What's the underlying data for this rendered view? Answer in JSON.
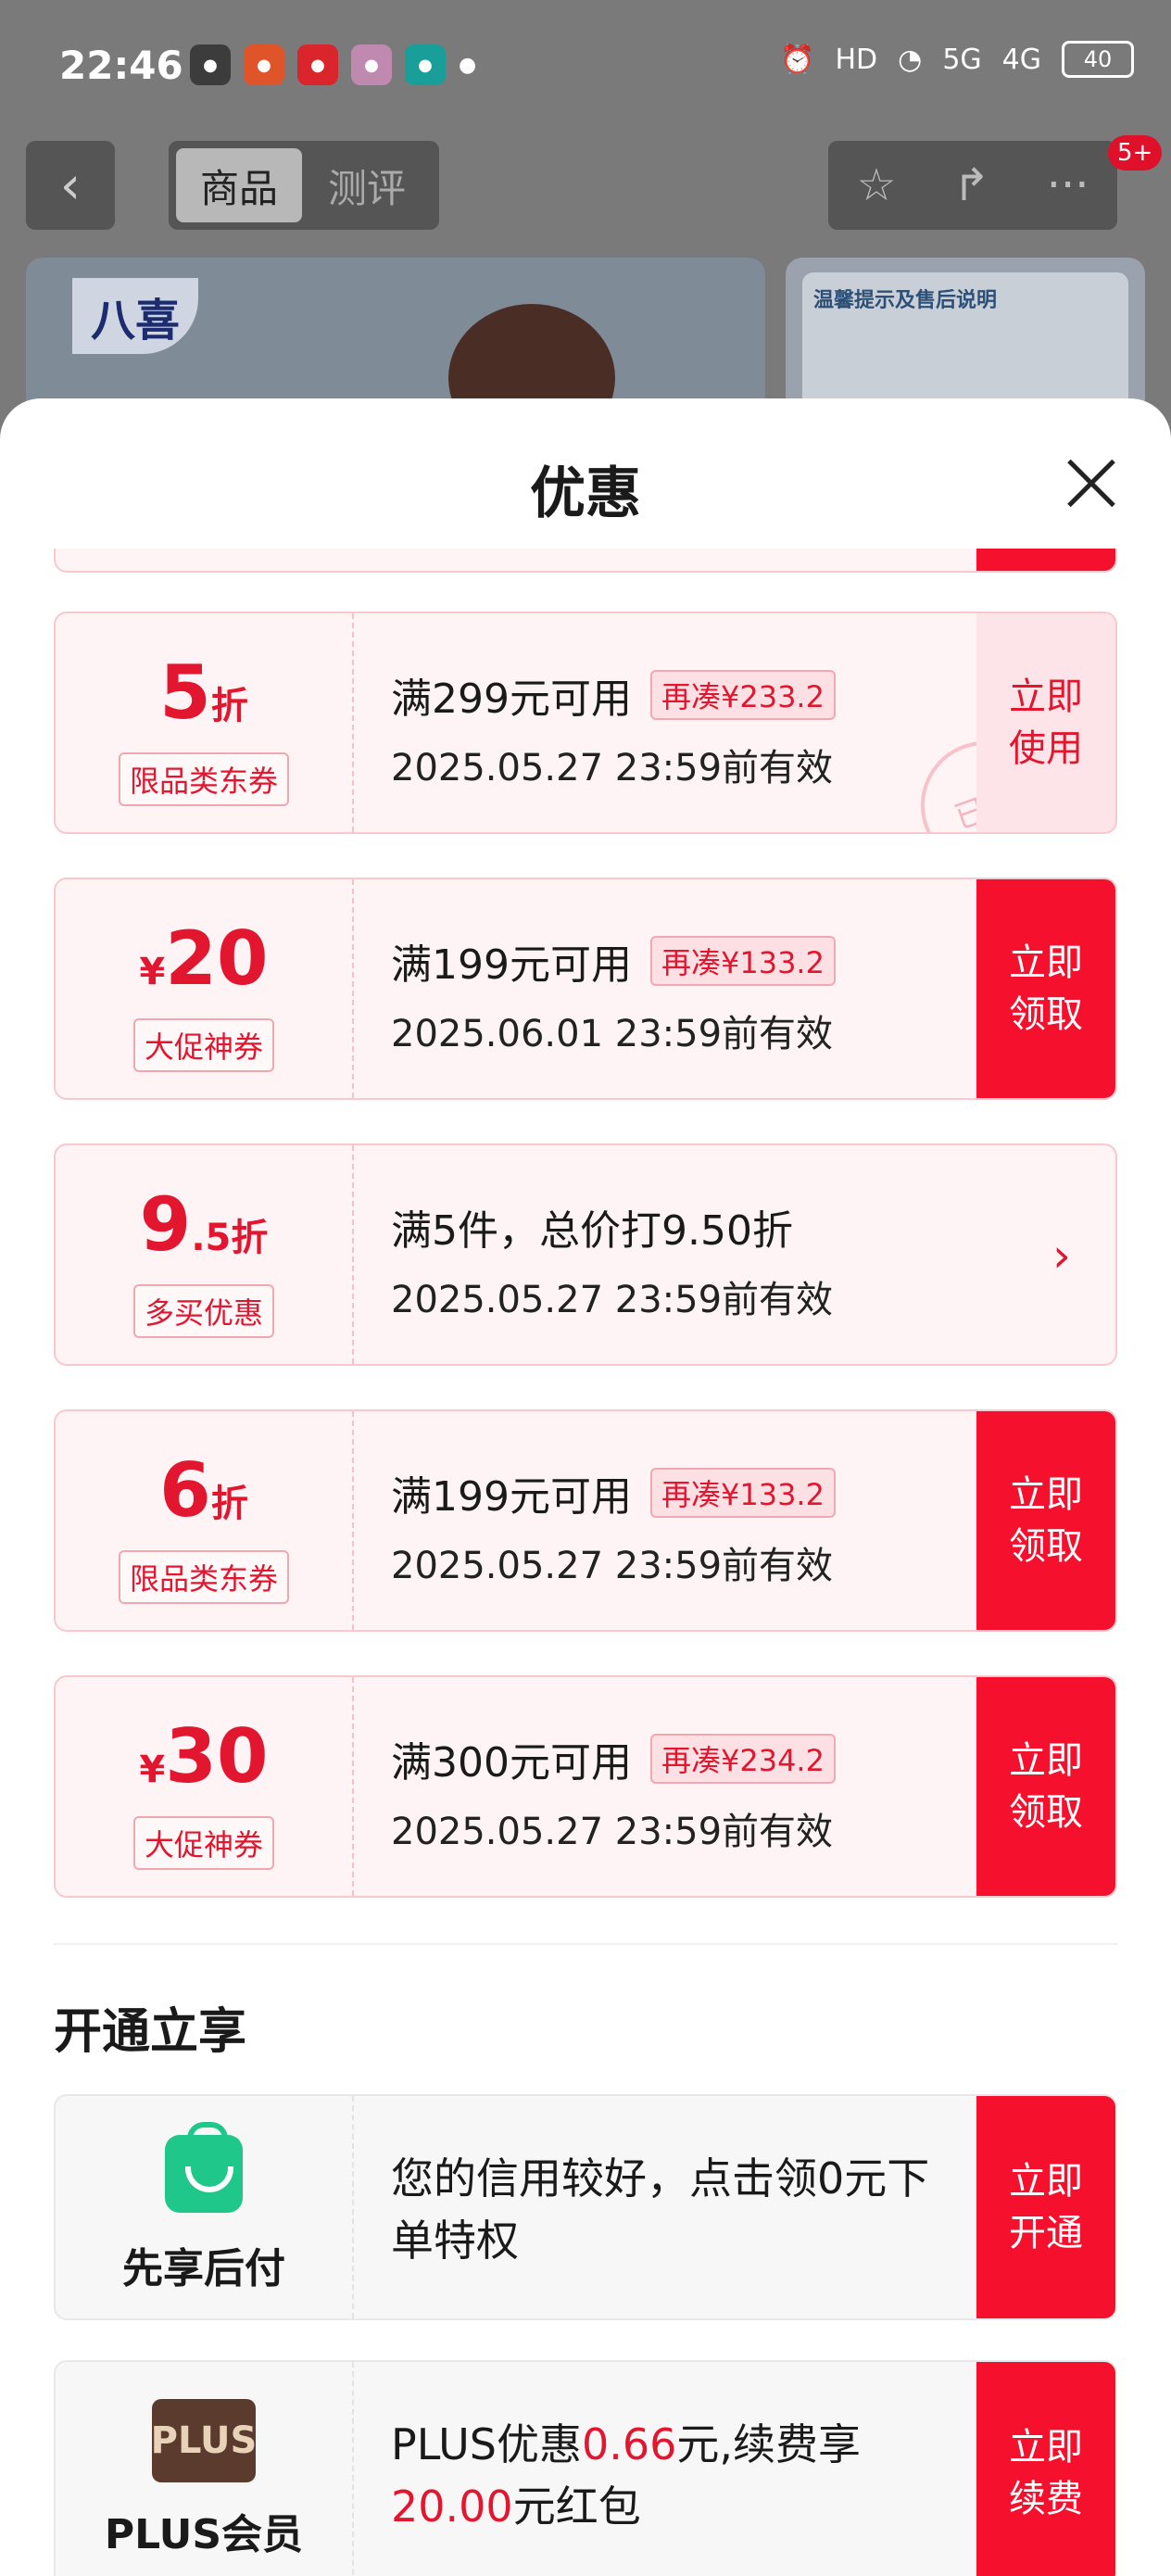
{
  "status": {
    "time": "22:46",
    "battery": "40",
    "signal": [
      "HD",
      "5G",
      "4G"
    ]
  },
  "nav": {
    "tab_goods": "商品",
    "tab_review": "测评",
    "badge": "5+"
  },
  "background": {
    "brand_text": "八喜",
    "notice_title": "温馨提示及售后说明"
  },
  "sheet": {
    "title": "优惠"
  },
  "coupons": [
    {
      "amount": "5",
      "unit": "折",
      "tag": "限品类东券",
      "condition": "满299元可用",
      "extra": "再凑¥233.2",
      "valid": "2025.05.27 23:59前有效",
      "action": "立即使用",
      "stamp": "已领"
    },
    {
      "currency": "¥",
      "amount": "20",
      "tag": "大促神券",
      "condition": "满199元可用",
      "extra": "再凑¥133.2",
      "valid": "2025.06.01 23:59前有效",
      "action": "立即领取"
    },
    {
      "amount": "9",
      "amount_dec": ".5",
      "unit": "折",
      "tag": "多买优惠",
      "condition": "满5件，总价打9.50折",
      "valid": "2025.05.27 23:59前有效",
      "action": "›"
    },
    {
      "amount": "6",
      "unit": "折",
      "tag": "限品类东券",
      "condition": "满199元可用",
      "extra": "再凑¥133.2",
      "valid": "2025.05.27 23:59前有效",
      "action": "立即领取"
    },
    {
      "currency": "¥",
      "amount": "30",
      "tag": "大促神券",
      "condition": "满300元可用",
      "extra": "再凑¥234.2",
      "valid": "2025.05.27 23:59前有效",
      "action": "立即领取"
    }
  ],
  "open_section": {
    "title": "开通立享",
    "perks": [
      {
        "name": "先享后付",
        "text": "您的信用较好，点击领0元下单特权",
        "action": "立即开通"
      },
      {
        "name": "PLUS会员",
        "icon_text": "PLUS",
        "text_a": "PLUS优惠",
        "text_b": "0.66",
        "text_c": "元,续费享",
        "text_d": "20.00",
        "text_e": "元红包",
        "action": "立即续费"
      }
    ]
  }
}
